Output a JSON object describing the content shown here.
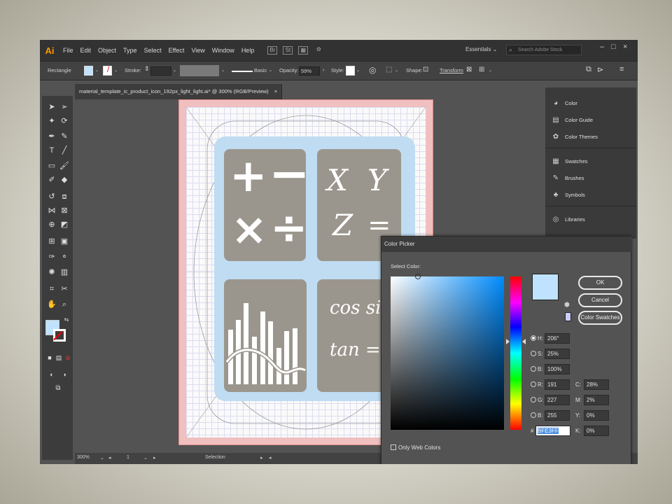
{
  "app": {
    "logo": "Ai",
    "menus": [
      "File",
      "Edit",
      "Object",
      "Type",
      "Select",
      "Effect",
      "View",
      "Window",
      "Help"
    ],
    "menubar_icons": [
      "Br",
      "St"
    ],
    "workspace": "Essentials",
    "search_placeholder": "Search Adobe Stock",
    "window_buttons": [
      "–",
      "□",
      "×"
    ]
  },
  "control_bar": {
    "tool_label": "Rectangle",
    "stroke_label": "Stroke:",
    "brush_label": "Basic",
    "opacity_label": "Opacity:",
    "opacity_value": "59%",
    "style_label": "Style:",
    "shape_label": "Shape:",
    "transform_label": "Transform",
    "fill_color": "#bfe3ff"
  },
  "document": {
    "tab_title": "material_template_ic_product_icon_192px_light_light.ai* @ 300% (RGB/Preview)",
    "tab_close": "×"
  },
  "artwork": {
    "card1_symbols": [
      "+",
      "−",
      "×",
      "÷"
    ],
    "card2_text": [
      "X",
      "Y",
      "Z",
      "="
    ],
    "card4_line1": "cos sin",
    "card4_line2": "tan ="
  },
  "right_panel": {
    "items": [
      "Color",
      "Color Guide",
      "Color Themes",
      "Swatches",
      "Brushes",
      "Symbols",
      "Libraries"
    ]
  },
  "status_bar": {
    "zoom": "300%",
    "artboard_num": "1",
    "selection_text": "Selection"
  },
  "color_picker": {
    "title": "Color Picker",
    "select_label": "Select Color:",
    "buttons": {
      "ok": "OK",
      "cancel": "Cancel",
      "swatches": "Color Swatches"
    },
    "hsb": {
      "h_label": "H:",
      "h_value": "206°",
      "s_label": "S:",
      "s_value": "25%",
      "b_label": "B:",
      "b_value": "100%"
    },
    "rgb": {
      "r_label": "R:",
      "r_value": "191",
      "g_label": "G:",
      "g_value": "227",
      "b_label": "B:",
      "b_value": "255"
    },
    "cmyk": {
      "c_label": "C:",
      "c_value": "28%",
      "m_label": "M:",
      "m_value": "2%",
      "y_label": "Y:",
      "y_value": "0%",
      "k_label": "K:",
      "k_value": "0%"
    },
    "hex_label": "#",
    "hex_value": "BFE3FF",
    "web_only_label": "Only Web Colors",
    "selected_color": "#bfe3ff"
  }
}
